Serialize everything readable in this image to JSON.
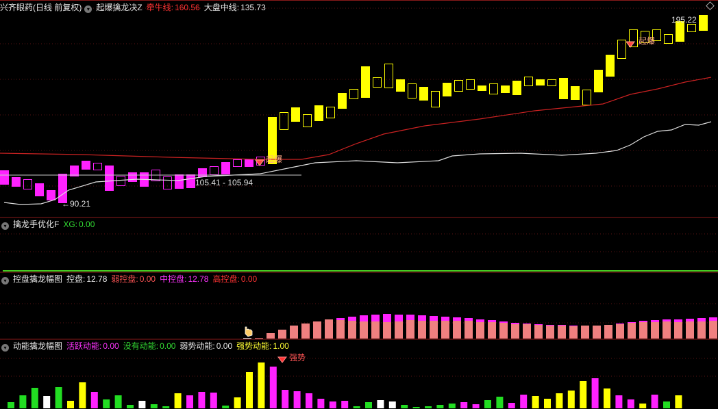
{
  "panel1": {
    "stock_name": "兴齐眼药(日线 前复权)",
    "indicator": "起爆擒龙决Z",
    "line1_label": "牵牛线:",
    "line1_value": "160.56",
    "line2_label": "大盘中线:",
    "line2_value": "135.73",
    "price_high_label": "195.22",
    "price_low_label": "90.21",
    "range_label": "105.41 - 105.94",
    "signal1_text": "起爆",
    "signal2_text": "起爆"
  },
  "panel2": {
    "indicator": "擒龙手优化F",
    "xg_label": "XG:",
    "xg_value": "0.00"
  },
  "panel3": {
    "indicator": "控盘擒龙幅图",
    "v1_label": "控盘:",
    "v1_value": "12.78",
    "v2_label": "弱控盘:",
    "v2_value": "0.00",
    "v3_label": "中控盘:",
    "v3_value": "12.78",
    "v4_label": "高控盘:",
    "v4_value": "0.00"
  },
  "panel4": {
    "indicator": "动能擒龙幅图",
    "v1_label": "活跃动能:",
    "v1_value": "0.00",
    "v2_label": "没有动能:",
    "v2_value": "0.00",
    "v3_label": "弱势动能:",
    "v3_value": "0.00",
    "v4_label": "强势动能:",
    "v4_value": "1.00",
    "signal_text": "强势"
  },
  "colors": {
    "bg": "#000000",
    "yellow": "#ffff00",
    "magenta": "#ff22ff",
    "green": "#22dd22",
    "salmon": "#f08080",
    "red_line": "#cc2222",
    "white_line": "#e0e0e0"
  }
}
